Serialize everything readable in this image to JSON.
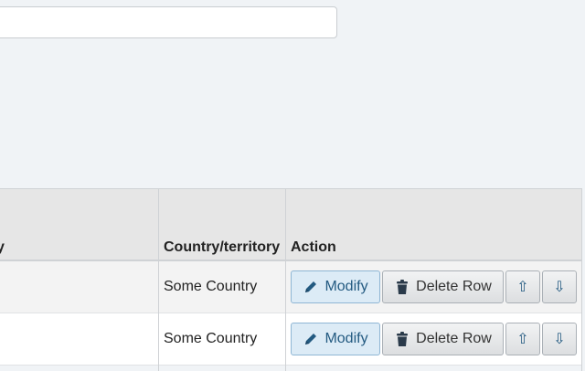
{
  "search": {
    "value": ""
  },
  "table": {
    "headers": {
      "partial": "y",
      "country": "Country/territory",
      "action": "Action"
    },
    "rows": [
      {
        "country": "Some Country",
        "modify": "Modify",
        "delete": "Delete Row",
        "up": "⇧",
        "down": "⇩"
      },
      {
        "country": "Some Country",
        "modify": "Modify",
        "delete": "Delete Row",
        "up": "⇧",
        "down": "⇩"
      }
    ]
  },
  "colors": {
    "accent": "#235a81",
    "modify_bg": "#dcebf6"
  },
  "icons": {
    "modify": "pencil-icon",
    "delete": "trash-icon"
  }
}
